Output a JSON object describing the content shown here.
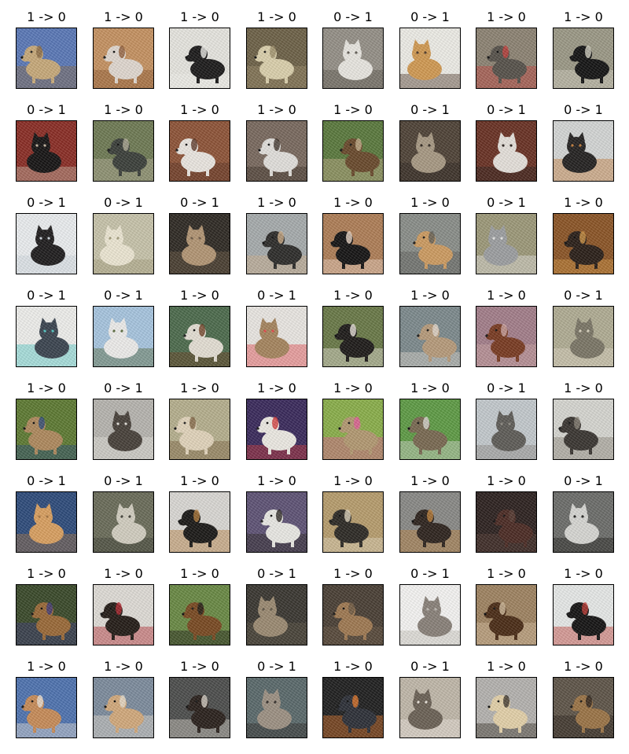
{
  "figure": {
    "rows": 8,
    "columns": 8,
    "panels": [
      {
        "title": "1 -> 0",
        "subject": "dog",
        "palette": {
          "bg": "#5b79b8",
          "subject": "#c9ab7b",
          "accent": "#8a6a45"
        }
      },
      {
        "title": "1 -> 0",
        "subject": "dog",
        "palette": {
          "bg": "#c79362",
          "subject": "#e3dad2",
          "accent": "#8f5a34"
        }
      },
      {
        "title": "1 -> 0",
        "subject": "dog",
        "palette": {
          "bg": "#e9e8e2",
          "subject": "#1c1b1b",
          "accent": "#f5f4ef"
        }
      },
      {
        "title": "1 -> 0",
        "subject": "dog",
        "palette": {
          "bg": "#6e6248",
          "subject": "#ddd2ae",
          "accent": "#9e8f6a"
        }
      },
      {
        "title": "0 -> 1",
        "subject": "cat",
        "palette": {
          "bg": "#969188",
          "subject": "#ebe9e3",
          "accent": "#5d5850"
        }
      },
      {
        "title": "0 -> 1",
        "subject": "cat",
        "palette": {
          "bg": "#f0efe9",
          "subject": "#d39b53",
          "accent": "#4f3a2b"
        }
      },
      {
        "title": "1 -> 0",
        "subject": "dog",
        "palette": {
          "bg": "#8e8474",
          "subject": "#57524b",
          "accent": "#c8433f"
        }
      },
      {
        "title": "1 -> 0",
        "subject": "dog",
        "palette": {
          "bg": "#9d9a87",
          "subject": "#141414",
          "accent": "#d7d5c6"
        }
      },
      {
        "title": "0 -> 1",
        "subject": "cat",
        "palette": {
          "bg": "#8b2d25",
          "subject": "#161414",
          "accent": "#c8b9a4"
        }
      },
      {
        "title": "1 -> 0",
        "subject": "dog",
        "palette": {
          "bg": "#6f7b54",
          "subject": "#3b3f3a",
          "accent": "#b7b29b"
        }
      },
      {
        "title": "1 -> 0",
        "subject": "dog",
        "palette": {
          "bg": "#8f5438",
          "subject": "#ede9e3",
          "accent": "#5a3424"
        }
      },
      {
        "title": "1 -> 0",
        "subject": "dog",
        "palette": {
          "bg": "#7a6a5f",
          "subject": "#e4e2de",
          "accent": "#3c3128"
        }
      },
      {
        "title": "1 -> 0",
        "subject": "dog",
        "palette": {
          "bg": "#5b7a3d",
          "subject": "#6a4a2c",
          "accent": "#c7b08d"
        }
      },
      {
        "title": "0 -> 1",
        "subject": "cat",
        "palette": {
          "bg": "#4f4337",
          "subject": "#a99a84",
          "accent": "#2d251e"
        }
      },
      {
        "title": "0 -> 1",
        "subject": "cat",
        "palette": {
          "bg": "#6a3224",
          "subject": "#e8e3dd",
          "accent": "#2a221e"
        }
      },
      {
        "title": "0 -> 1",
        "subject": "cat",
        "palette": {
          "bg": "#d6d8d7",
          "subject": "#242221",
          "accent": "#c77f3a"
        }
      },
      {
        "title": "0 -> 1",
        "subject": "cat",
        "palette": {
          "bg": "#edf0f2",
          "subject": "#1f1d1e",
          "accent": "#cfd6de"
        }
      },
      {
        "title": "0 -> 1",
        "subject": "cat",
        "palette": {
          "bg": "#c9c5ac",
          "subject": "#efe9d5",
          "accent": "#a39d7c"
        }
      },
      {
        "title": "0 -> 1",
        "subject": "cat",
        "palette": {
          "bg": "#2f2a24",
          "subject": "#b49775",
          "accent": "#6e5b47"
        }
      },
      {
        "title": "1 -> 0",
        "subject": "dog",
        "palette": {
          "bg": "#a8adae",
          "subject": "#2d2c2a",
          "accent": "#d2b28b"
        }
      },
      {
        "title": "1 -> 0",
        "subject": "dog",
        "palette": {
          "bg": "#b07f57",
          "subject": "#151414",
          "accent": "#f1dccb"
        }
      },
      {
        "title": "1 -> 0",
        "subject": "dog",
        "palette": {
          "bg": "#8b8f8a",
          "subject": "#cf9d62",
          "accent": "#5e5e58"
        }
      },
      {
        "title": "0 -> 1",
        "subject": "cat",
        "palette": {
          "bg": "#9e9a7a",
          "subject": "#9ea0a2",
          "accent": "#e8e8e6"
        }
      },
      {
        "title": "1 -> 0",
        "subject": "dog",
        "palette": {
          "bg": "#8c5526",
          "subject": "#2a1f18",
          "accent": "#d59947"
        }
      },
      {
        "title": "0 -> 1",
        "subject": "cat",
        "palette": {
          "bg": "#f1f1ee",
          "subject": "#3b4550",
          "accent": "#53c9c5"
        }
      },
      {
        "title": "0 -> 1",
        "subject": "cat",
        "palette": {
          "bg": "#a9c7e1",
          "subject": "#f0efed",
          "accent": "#596b3c"
        }
      },
      {
        "title": "1 -> 0",
        "subject": "dog",
        "palette": {
          "bg": "#4d6c4d",
          "subject": "#e7e1d6",
          "accent": "#6e3d22"
        }
      },
      {
        "title": "0 -> 1",
        "subject": "cat",
        "palette": {
          "bg": "#ece9e5",
          "subject": "#a7865f",
          "accent": "#e7484b"
        }
      },
      {
        "title": "1 -> 0",
        "subject": "dog",
        "palette": {
          "bg": "#6a7a48",
          "subject": "#1e1b19",
          "accent": "#efe9e0"
        }
      },
      {
        "title": "1 -> 0",
        "subject": "dog",
        "palette": {
          "bg": "#7e8b8e",
          "subject": "#b89c7c",
          "accent": "#e3dbd1"
        }
      },
      {
        "title": "1 -> 0",
        "subject": "dog",
        "palette": {
          "bg": "#a47f8b",
          "subject": "#7a3b22",
          "accent": "#cfa9a6"
        }
      },
      {
        "title": "0 -> 1",
        "subject": "cat",
        "palette": {
          "bg": "#b2ae95",
          "subject": "#7c7767",
          "accent": "#e0dac6"
        }
      },
      {
        "title": "1 -> 0",
        "subject": "dog",
        "palette": {
          "bg": "#5e7b33",
          "subject": "#b08a5e",
          "accent": "#2b4a7a"
        }
      },
      {
        "title": "0 -> 1",
        "subject": "cat",
        "palette": {
          "bg": "#b8b6b1",
          "subject": "#48413a",
          "accent": "#e9e6e0"
        }
      },
      {
        "title": "1 -> 0",
        "subject": "dog",
        "palette": {
          "bg": "#b7b18f",
          "subject": "#e4d6bd",
          "accent": "#7d6240"
        }
      },
      {
        "title": "1 -> 0",
        "subject": "dog",
        "palette": {
          "bg": "#3a2a5c",
          "subject": "#efece6",
          "accent": "#d23a3a"
        }
      },
      {
        "title": "1 -> 0",
        "subject": "dog",
        "palette": {
          "bg": "#8bb04b",
          "subject": "#b49a72",
          "accent": "#e35c9a"
        }
      },
      {
        "title": "1 -> 0",
        "subject": "dog",
        "palette": {
          "bg": "#5f9c46",
          "subject": "#7a6a52",
          "accent": "#dcdcd4"
        }
      },
      {
        "title": "0 -> 1",
        "subject": "cat",
        "palette": {
          "bg": "#c5cbcf",
          "subject": "#5f5d58",
          "accent": "#8e8a83"
        }
      },
      {
        "title": "1 -> 0",
        "subject": "dog",
        "palette": {
          "bg": "#d8d8d3",
          "subject": "#3a3632",
          "accent": "#8b8478"
        }
      },
      {
        "title": "0 -> 1",
        "subject": "cat",
        "palette": {
          "bg": "#2e4c7c",
          "subject": "#dba161",
          "accent": "#a67643"
        }
      },
      {
        "title": "0 -> 1",
        "subject": "cat",
        "palette": {
          "bg": "#6b6d5a",
          "subject": "#d4d0c2",
          "accent": "#3e3d35"
        }
      },
      {
        "title": "1 -> 0",
        "subject": "dog",
        "palette": {
          "bg": "#dcdad6",
          "subject": "#1b1917",
          "accent": "#b57d3c"
        }
      },
      {
        "title": "1 -> 0",
        "subject": "dog",
        "palette": {
          "bg": "#5f5376",
          "subject": "#ecebe7",
          "accent": "#2a2622"
        }
      },
      {
        "title": "1 -> 0",
        "subject": "dog",
        "palette": {
          "bg": "#b89e6e",
          "subject": "#2d2a25",
          "accent": "#e2d8c1"
        }
      },
      {
        "title": "1 -> 0",
        "subject": "dog",
        "palette": {
          "bg": "#8a8a87",
          "subject": "#2e241e",
          "accent": "#c0823b"
        }
      },
      {
        "title": "1 -> 0",
        "subject": "dog",
        "palette": {
          "bg": "#2d2220",
          "subject": "#4c2b24",
          "accent": "#5a4037"
        }
      },
      {
        "title": "0 -> 1",
        "subject": "cat",
        "palette": {
          "bg": "#6d6e6b",
          "subject": "#d9d9d5",
          "accent": "#1f1f1d"
        }
      },
      {
        "title": "1 -> 0",
        "subject": "dog",
        "palette": {
          "bg": "#3a4a2a",
          "subject": "#9b6a38",
          "accent": "#3d3a7a"
        }
      },
      {
        "title": "1 -> 0",
        "subject": "dog",
        "palette": {
          "bg": "#e1ded8",
          "subject": "#241c17",
          "accent": "#b62b33"
        }
      },
      {
        "title": "1 -> 0",
        "subject": "dog",
        "palette": {
          "bg": "#6a8a45",
          "subject": "#7a4a22",
          "accent": "#1f1b17"
        }
      },
      {
        "title": "0 -> 1",
        "subject": "cat",
        "palette": {
          "bg": "#3a3731",
          "subject": "#9c8b72",
          "accent": "#5f5647"
        }
      },
      {
        "title": "1 -> 0",
        "subject": "dog",
        "palette": {
          "bg": "#4a3f35",
          "subject": "#a07a52",
          "accent": "#6d5a45"
        }
      },
      {
        "title": "0 -> 1",
        "subject": "cat",
        "palette": {
          "bg": "#f8f7f5",
          "subject": "#8a827a",
          "accent": "#c4bfb8"
        }
      },
      {
        "title": "1 -> 0",
        "subject": "dog",
        "palette": {
          "bg": "#a08462",
          "subject": "#4b2c16",
          "accent": "#d7c2a1"
        }
      },
      {
        "title": "1 -> 0",
        "subject": "dog",
        "palette": {
          "bg": "#e9ebea",
          "subject": "#151414",
          "accent": "#c23c36"
        }
      },
      {
        "title": "1 -> 0",
        "subject": "dog",
        "palette": {
          "bg": "#4f74b1",
          "subject": "#c98d59",
          "accent": "#ece4d9"
        }
      },
      {
        "title": "1 -> 0",
        "subject": "dog",
        "palette": {
          "bg": "#7e8d9e",
          "subject": "#d4ab7d",
          "accent": "#e9e0d0"
        }
      },
      {
        "title": "1 -> 0",
        "subject": "dog",
        "palette": {
          "bg": "#4d4e4d",
          "subject": "#2a211c",
          "accent": "#dcd6cc"
        }
      },
      {
        "title": "0 -> 1",
        "subject": "cat",
        "palette": {
          "bg": "#5b6a6c",
          "subject": "#9e9284",
          "accent": "#2f2a27"
        }
      },
      {
        "title": "1 -> 0",
        "subject": "dog",
        "palette": {
          "bg": "#202020",
          "subject": "#2d3038",
          "accent": "#e2782a"
        }
      },
      {
        "title": "0 -> 1",
        "subject": "cat",
        "palette": {
          "bg": "#c2b9ab",
          "subject": "#6c6256",
          "accent": "#efe9e0"
        }
      },
      {
        "title": "1 -> 0",
        "subject": "dog",
        "palette": {
          "bg": "#b6b4b1",
          "subject": "#e6d3ab",
          "accent": "#3a322a"
        }
      },
      {
        "title": "1 -> 0",
        "subject": "dog",
        "palette": {
          "bg": "#5f5549",
          "subject": "#9c7547",
          "accent": "#2a221b"
        }
      }
    ]
  }
}
